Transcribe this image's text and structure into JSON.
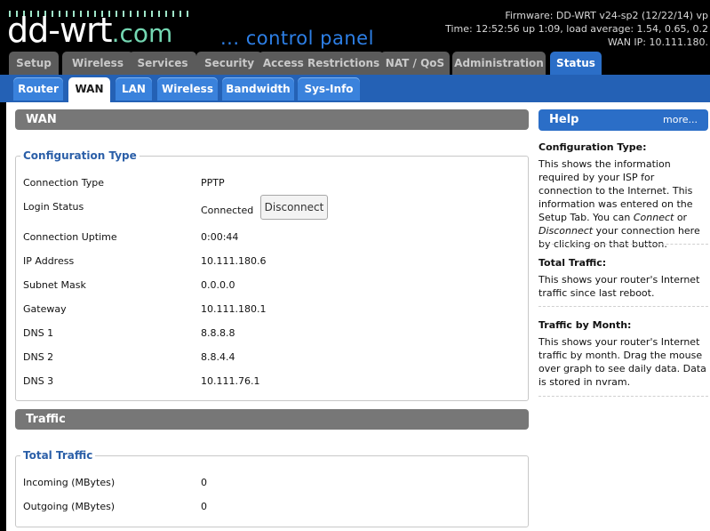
{
  "header": {
    "logo_main": "dd-wrt",
    "logo_suffix": ".com",
    "subtitle": "... control panel",
    "firmware": "Firmware: DD-WRT v24-sp2 (12/22/14) vp",
    "time": "Time: 12:52:56 up 1:09, load average: 1.54, 0.65, 0.2",
    "wan_ip": "WAN IP: 10.111.180."
  },
  "main_tabs": [
    "Setup",
    "Wireless",
    "Services",
    "Security",
    "Access Restrictions",
    "NAT / QoS",
    "Administration",
    "Status"
  ],
  "sub_tabs": [
    "Router",
    "WAN",
    "LAN",
    "Wireless",
    "Bandwidth",
    "Sys-Info"
  ],
  "wan": {
    "section_title": "WAN",
    "legend": "Configuration Type",
    "disconnect_label": "Disconnect",
    "rows": [
      {
        "label": "Connection Type",
        "value": "PPTP"
      },
      {
        "label": "Login Status",
        "value": "Connected"
      },
      {
        "label": "Connection Uptime",
        "value": "0:00:44"
      },
      {
        "label": "IP Address",
        "value": "10.111.180.6"
      },
      {
        "label": "Subnet Mask",
        "value": "0.0.0.0"
      },
      {
        "label": "Gateway",
        "value": "10.111.180.1"
      },
      {
        "label": "DNS 1",
        "value": "8.8.8.8"
      },
      {
        "label": "DNS 2",
        "value": "8.8.4.4"
      },
      {
        "label": "DNS 3",
        "value": "10.111.76.1"
      }
    ]
  },
  "traffic": {
    "section_title": "Traffic",
    "legend": "Total Traffic",
    "rows": [
      {
        "label": "Incoming (MBytes)",
        "value": "0"
      },
      {
        "label": "Outgoing (MBytes)",
        "value": "0"
      }
    ]
  },
  "help": {
    "title": "Help",
    "more": "more...",
    "blocks": [
      {
        "heading": "Configuration Type:",
        "text_pre": "This shows the information required by your ISP for connection to the Internet. This information was entered on the Setup Tab. You can ",
        "em1": "Connect",
        "text_mid": " or ",
        "em2": "Disconnect",
        "text_post": " your connection here by clicking on that button."
      },
      {
        "heading": "Total Traffic:",
        "text": "This shows your router's Internet traffic since last reboot."
      },
      {
        "heading": "Traffic by Month:",
        "text": "This shows your router's Internet traffic by month. Drag the mouse over graph to see daily data. Data is stored in nvram."
      }
    ]
  },
  "colors": {
    "accent_blue": "#2b6ec7",
    "section_gray": "#777777",
    "legend_blue": "#2b5fa8",
    "logo_accent": "#74d7b2"
  }
}
